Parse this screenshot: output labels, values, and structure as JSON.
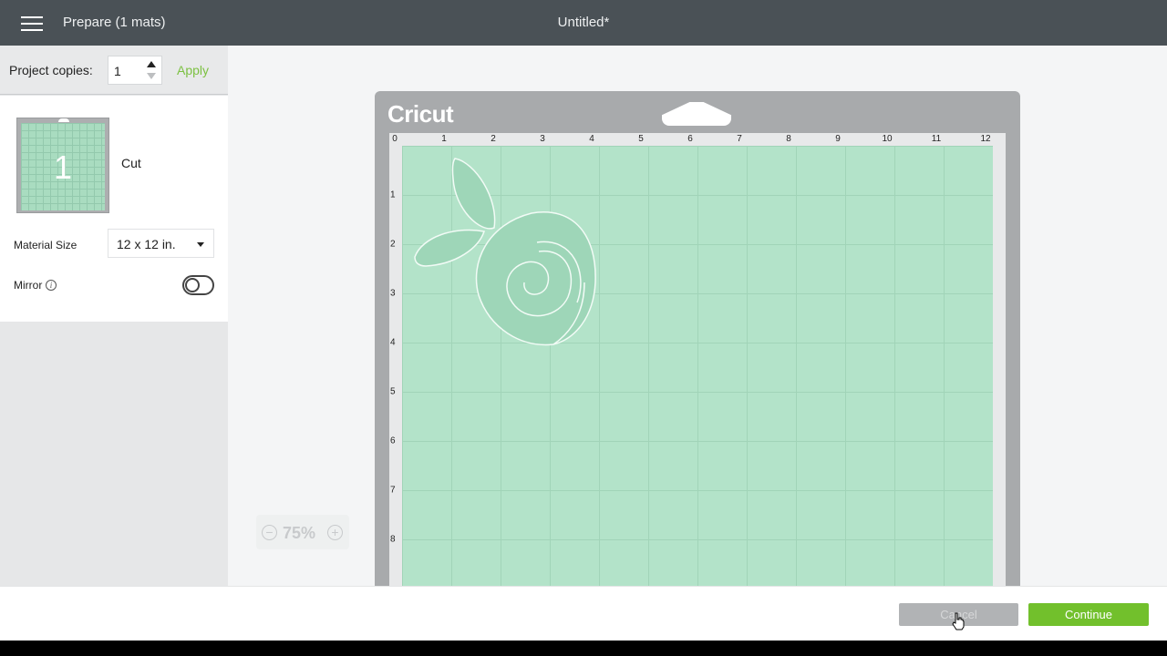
{
  "header": {
    "menu_icon": "hamburger-menu-icon",
    "title": "Prepare (1 mats)",
    "document_title": "Untitled*"
  },
  "sidebar": {
    "copies_label": "Project copies:",
    "copies_value": "1",
    "apply_label": "Apply",
    "mat_number": "1",
    "mat_label": "Cut",
    "material_size_label": "Material Size",
    "material_size_value": "12 x 12 in.",
    "mirror_label": "Mirror",
    "mirror_on": false,
    "info_icon_glyph": "i"
  },
  "mat": {
    "brand": "Cricut",
    "x_ticks": [
      "0",
      "1",
      "2",
      "3",
      "4",
      "5",
      "6",
      "7",
      "8",
      "9",
      "10",
      "11",
      "12"
    ],
    "y_ticks": [
      "1",
      "2",
      "3",
      "4",
      "5",
      "6",
      "7",
      "8"
    ]
  },
  "zoom": {
    "value": "75%",
    "out_glyph": "−",
    "in_glyph": "+"
  },
  "footer": {
    "cancel_label": "Cancel",
    "continue_label": "Continue"
  },
  "colors": {
    "header_bg": "#4a5156",
    "accent_green": "#72c02c",
    "mat_green": "#b3e3c9"
  }
}
